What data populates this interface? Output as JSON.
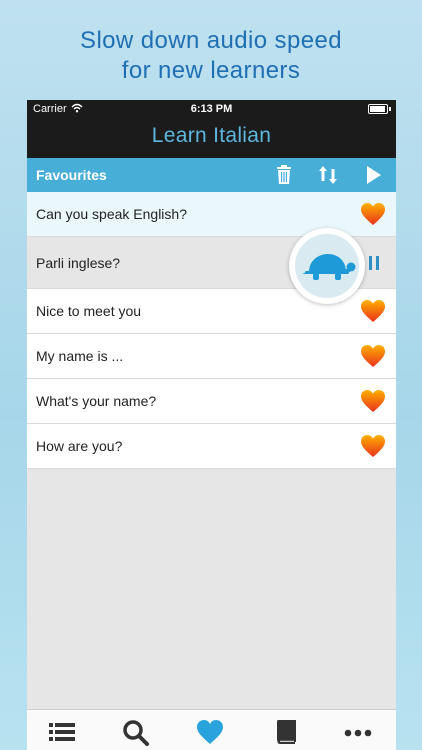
{
  "headline": {
    "line1": "Slow down audio speed",
    "line2": "for new learners"
  },
  "status": {
    "carrier": "Carrier",
    "time": "6:13 PM"
  },
  "app_title": "Learn Italian",
  "section": {
    "title": "Favourites"
  },
  "phrases": [
    {
      "text": "Can you speak English?",
      "state": "selected",
      "favourite": true
    },
    {
      "text": "Parli inglese?",
      "state": "playing",
      "favourite": true
    },
    {
      "text": "Nice to meet you",
      "state": "normal",
      "favourite": true
    },
    {
      "text": "My name is ...",
      "state": "normal",
      "favourite": true
    },
    {
      "text": "What's your name?",
      "state": "normal",
      "favourite": true
    },
    {
      "text": "How are you?",
      "state": "normal",
      "favourite": true
    }
  ],
  "icons": {
    "section_tools": [
      "trash-icon",
      "sort-icon",
      "play-icon"
    ],
    "tabs": [
      "list-icon",
      "search-icon",
      "heart-icon",
      "book-icon",
      "more-icon"
    ],
    "badge": "turtle-icon"
  },
  "colors": {
    "accent": "#47aed8",
    "title_text": "#5db7df",
    "headline": "#1f6fb4",
    "heart_top": "#ffb000",
    "heart_bottom": "#e8321c"
  }
}
